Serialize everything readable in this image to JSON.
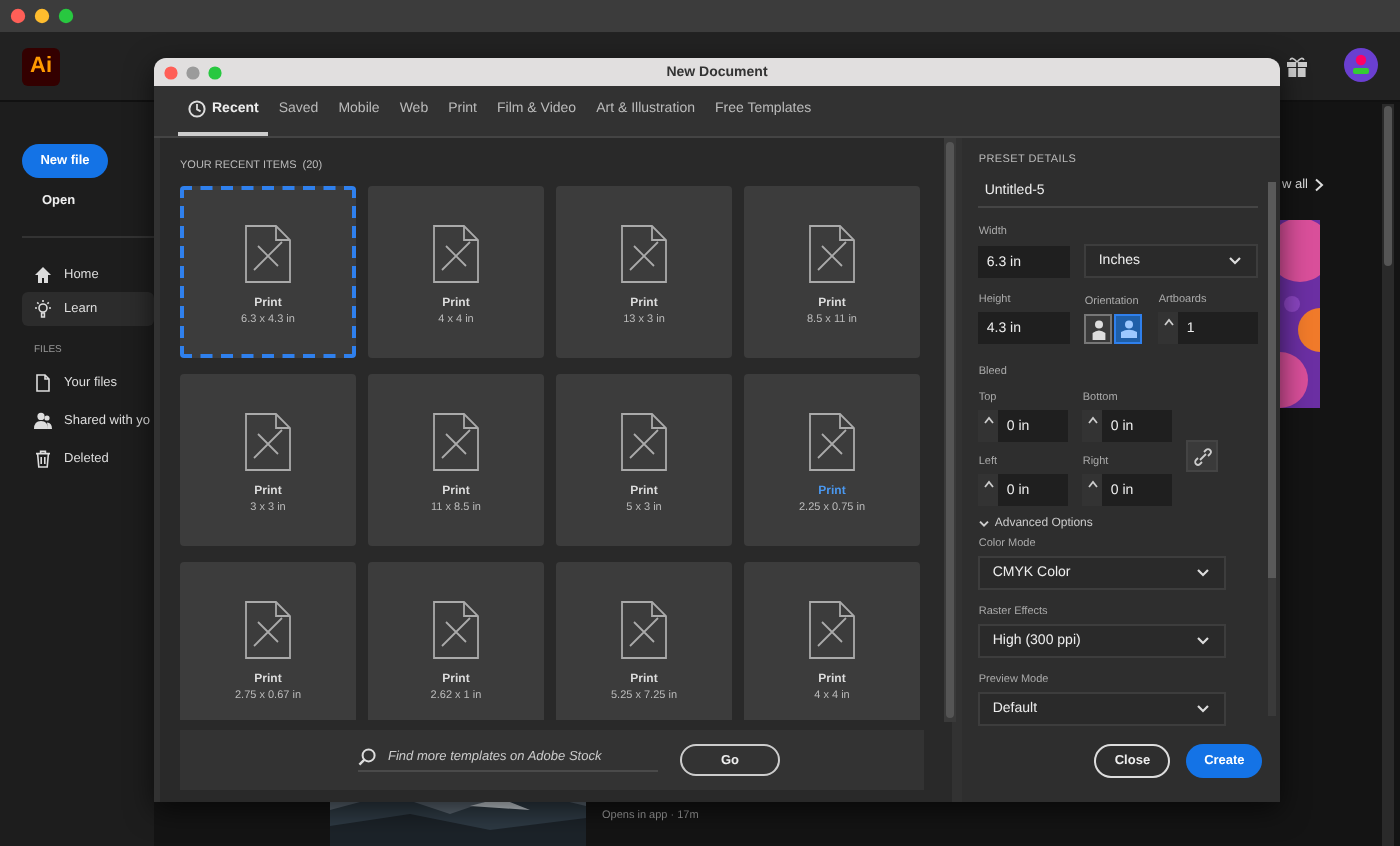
{
  "app": {
    "logo": "Ai",
    "new_file": "New file",
    "open": "Open",
    "nav": [
      {
        "label": "Home",
        "selected": false
      },
      {
        "label": "Learn",
        "selected": true
      }
    ],
    "files_heading": "FILES",
    "files": [
      {
        "label": "Your files"
      },
      {
        "label": "Shared with yo"
      },
      {
        "label": "Deleted"
      }
    ],
    "view_all": "w all",
    "recent_meta": "Opens in app · 17m"
  },
  "dialog": {
    "title": "New Document",
    "tabs": [
      {
        "label": "Recent",
        "selected": true
      },
      {
        "label": "Saved",
        "selected": false
      },
      {
        "label": "Mobile",
        "selected": false
      },
      {
        "label": "Web",
        "selected": false
      },
      {
        "label": "Print",
        "selected": false
      },
      {
        "label": "Film & Video",
        "selected": false
      },
      {
        "label": "Art & Illustration",
        "selected": false
      },
      {
        "label": "Free Templates",
        "selected": false
      }
    ],
    "recent_heading": "YOUR RECENT ITEMS",
    "recent_count": "(20)",
    "items": [
      {
        "title": "Print",
        "size": "6.3 x 4.3 in",
        "selected": true,
        "hovered": false
      },
      {
        "title": "Print",
        "size": "4 x 4 in",
        "selected": false,
        "hovered": false
      },
      {
        "title": "Print",
        "size": "13 x 3 in",
        "selected": false,
        "hovered": false
      },
      {
        "title": "Print",
        "size": "8.5 x 11 in",
        "selected": false,
        "hovered": false
      },
      {
        "title": "Print",
        "size": "3 x 3 in",
        "selected": false,
        "hovered": false
      },
      {
        "title": "Print",
        "size": "11 x 8.5 in",
        "selected": false,
        "hovered": false
      },
      {
        "title": "Print",
        "size": "5 x 3 in",
        "selected": false,
        "hovered": false
      },
      {
        "title": "Print",
        "size": "2.25 x 0.75 in",
        "selected": false,
        "hovered": true
      },
      {
        "title": "Print",
        "size": "2.75 x 0.67 in",
        "selected": false,
        "hovered": false
      },
      {
        "title": "Print",
        "size": "2.62 x 1 in",
        "selected": false,
        "hovered": false
      },
      {
        "title": "Print",
        "size": "5.25 x 7.25 in",
        "selected": false,
        "hovered": false
      },
      {
        "title": "Print",
        "size": "4 x 4 in",
        "selected": false,
        "hovered": false
      }
    ],
    "search_placeholder": "Find more templates on Adobe Stock",
    "go": "Go",
    "preset": {
      "heading": "PRESET DETAILS",
      "name": "Untitled-5",
      "width_label": "Width",
      "width": "6.3 in",
      "units": "Inches",
      "height_label": "Height",
      "height": "4.3 in",
      "orientation_label": "Orientation",
      "orientations": [
        {
          "kind": "portrait",
          "selected": false
        },
        {
          "kind": "landscape",
          "selected": true
        }
      ],
      "artboards_label": "Artboards",
      "artboards": "1",
      "bleed_label": "Bleed",
      "bleed": [
        {
          "label": "Top",
          "value": "0 in"
        },
        {
          "label": "Bottom",
          "value": "0 in"
        },
        {
          "label": "Left",
          "value": "0 in"
        },
        {
          "label": "Right",
          "value": "0 in"
        }
      ],
      "advanced_label": "Advanced Options",
      "advanced_expanded": true,
      "selects": [
        {
          "label": "Color Mode",
          "value": "CMYK Color"
        },
        {
          "label": "Raster Effects",
          "value": "High (300 ppi)"
        },
        {
          "label": "Preview Mode",
          "value": "Default"
        }
      ],
      "close": "Close",
      "create": "Create"
    }
  }
}
